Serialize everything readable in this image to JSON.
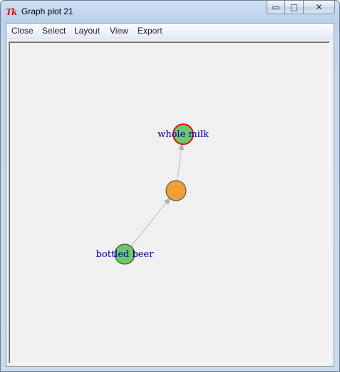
{
  "window": {
    "title": "Graph plot 21",
    "app_icon_text": "Tk",
    "controls": {
      "minimize": "▭",
      "maximize": "□",
      "close": "✕"
    }
  },
  "menu": {
    "items": [
      "Close",
      "Select",
      "Layout",
      "View",
      "Export"
    ]
  },
  "graph": {
    "nodes": [
      {
        "id": "whole_milk",
        "label": "whole milk",
        "fill": "#6cc96a",
        "stroke": "#e01010",
        "role": "item"
      },
      {
        "id": "rule",
        "label": "",
        "fill": "#f0a037",
        "stroke": "#444444",
        "role": "rule"
      },
      {
        "id": "bottled_beer",
        "label": "bottled beer",
        "fill": "#6cc96a",
        "stroke": "#333333",
        "role": "item"
      }
    ],
    "edges": [
      {
        "from": "bottled_beer",
        "to": "rule"
      },
      {
        "from": "rule",
        "to": "whole_milk"
      }
    ],
    "edge_color": "#b8b8b8",
    "label_color": "#00008b"
  }
}
